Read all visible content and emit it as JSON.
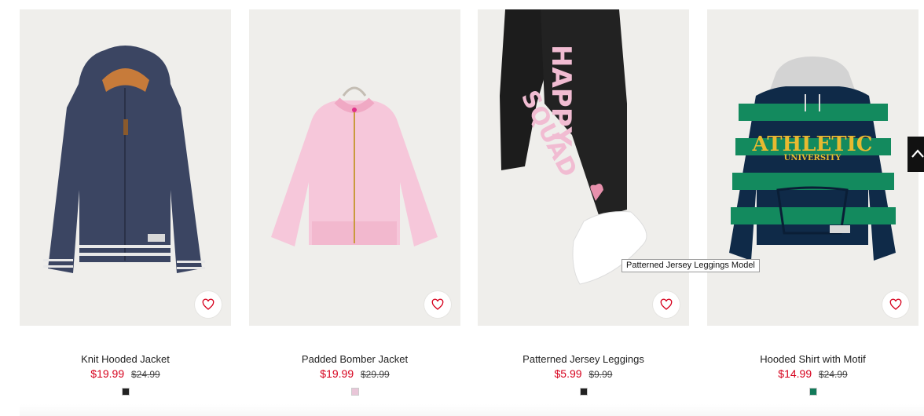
{
  "products": [
    {
      "name": "Knit Hooded Jacket",
      "price_sale": "$19.99",
      "price_old": "$24.99",
      "swatch_color": "#222222",
      "favorite_icon": "heart-outline-icon"
    },
    {
      "name": "Padded Bomber Jacket",
      "price_sale": "$19.99",
      "price_old": "$29.99",
      "swatch_color": "#e9c6d8",
      "favorite_icon": "heart-outline-icon"
    },
    {
      "name": "Patterned Jersey Leggings",
      "price_sale": "$5.99",
      "price_old": "$9.99",
      "swatch_color": "#222222",
      "favorite_icon": "heart-outline-icon"
    },
    {
      "name": "Hooded Shirt with Motif",
      "price_sale": "$14.99",
      "price_old": "$24.99",
      "swatch_color": "#137a5a",
      "favorite_icon": "heart-outline-icon"
    }
  ],
  "image_text": {
    "leggings_print_1": "HAPPY",
    "leggings_print_2": "SQUAD",
    "hoodie_print_1": "ATHLETIC",
    "hoodie_print_2": "UNIVERSITY"
  },
  "tooltip": {
    "text": "Patterned Jersey Leggings Model"
  },
  "scroll_top": {
    "icon": "chevron-up-icon"
  },
  "colors": {
    "sale_price": "#d6001c",
    "image_background": "#efeeeb",
    "favorite_icon": "#d6001c"
  }
}
